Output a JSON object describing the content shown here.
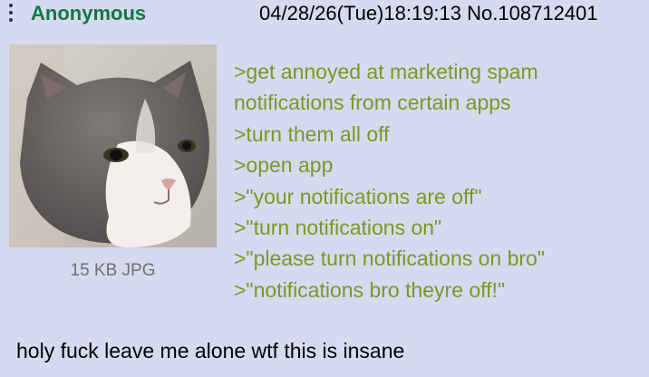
{
  "post": {
    "name": "Anonymous",
    "datetime": "04/28/26(Tue)18:19:13",
    "post_number": "No.108712401",
    "file": {
      "size_label": "15 KB JPG",
      "thumbnail_subject": "gray-and-white cat photo"
    },
    "greentext": [
      ">get annoyed at marketing spam",
      "notifications from certain apps",
      ">turn them all off",
      ">open app",
      ">\"your notifications are off\"",
      ">\"turn notifications on\"",
      ">\"please turn notifications on bro\"",
      ">\"notifications bro theyre off!\""
    ],
    "comment": "holy fuck leave me alone wtf this is insane"
  },
  "colors": {
    "background": "#d6daf0",
    "name": "#117743",
    "greentext": "#789922",
    "file_info": "#707070"
  }
}
